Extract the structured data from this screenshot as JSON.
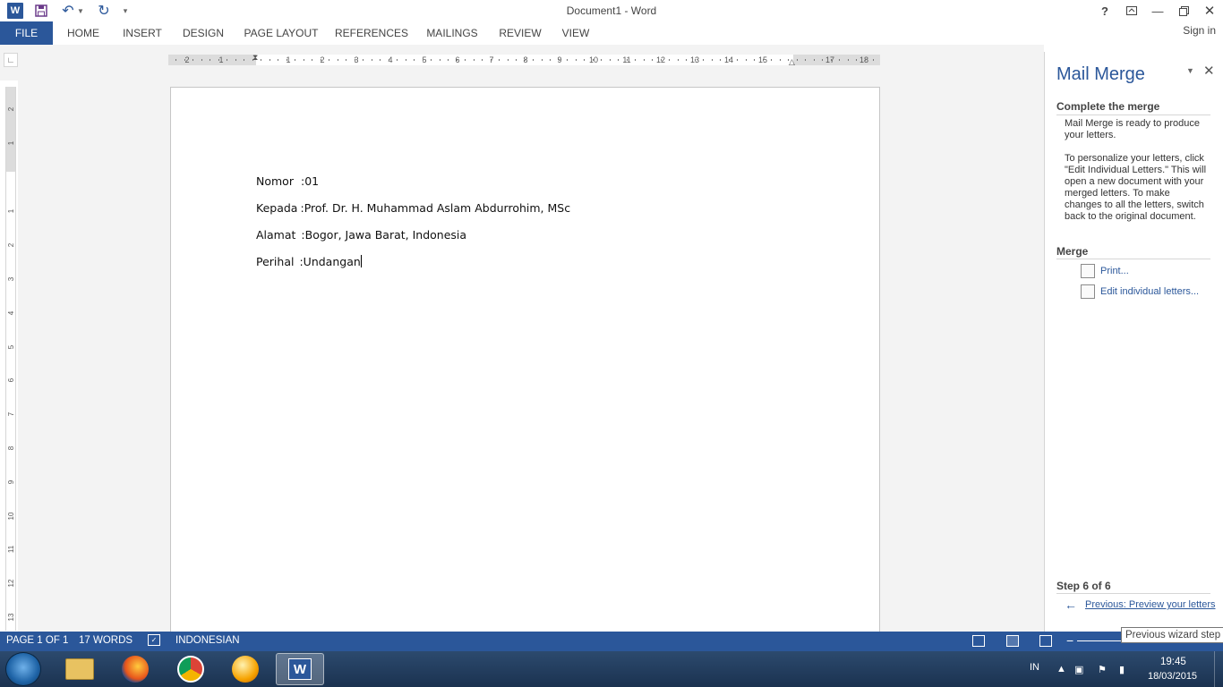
{
  "window": {
    "title": "Document1 - Word",
    "sign_in": "Sign in",
    "app_icon_letter": "W"
  },
  "ribbon": {
    "tabs": [
      "FILE",
      "HOME",
      "INSERT",
      "DESIGN",
      "PAGE LAYOUT",
      "REFERENCES",
      "MAILINGS",
      "REVIEW",
      "VIEW"
    ],
    "active_tab": "FILE"
  },
  "ruler": {
    "horizontal_labels": [
      "2",
      "1",
      "1",
      "2",
      "3",
      "4",
      "5",
      "6",
      "7",
      "8",
      "9",
      "10",
      "11",
      "12",
      "13",
      "14",
      "15",
      "17",
      "18"
    ],
    "vertical_labels": [
      "2",
      "1",
      "1",
      "2",
      "3",
      "4",
      "5",
      "6",
      "7",
      "8",
      "9",
      "10",
      "11",
      "12",
      "13"
    ]
  },
  "document": {
    "lines": [
      {
        "label": "Nomor",
        "sep": ":",
        "value": "01"
      },
      {
        "label": "Kepada",
        "sep": ":",
        "value": "Prof. Dr. H. Muhammad Aslam Abdurrohim, MSc"
      },
      {
        "label": "Alamat",
        "sep": ":",
        "value": "Bogor, Jawa Barat, Indonesia"
      },
      {
        "label": "Perihal",
        "sep": ":",
        "value": "Undangan"
      }
    ]
  },
  "task_pane": {
    "title": "Mail Merge",
    "section1_heading": "Complete the merge",
    "para1": "Mail Merge is ready to produce your letters.",
    "para2": "To personalize your letters, click \"Edit Individual Letters.\" This will open a new document with your merged letters. To make changes to all the letters, switch back to the original document.",
    "section2_heading": "Merge",
    "print_link": "Print...",
    "edit_link": "Edit individual letters...",
    "step": "Step 6 of 6",
    "previous_link": "Previous: Preview your letters"
  },
  "status_bar": {
    "page": "PAGE 1 OF 1",
    "words": "17 WORDS",
    "language": "INDONESIAN",
    "tooltip": "Previous wizard step"
  },
  "taskbar": {
    "language": "IN",
    "time": "19:45",
    "date": "18/03/2015"
  },
  "colors": {
    "accent": "#2b579a",
    "statusbar": "#2b579a"
  }
}
